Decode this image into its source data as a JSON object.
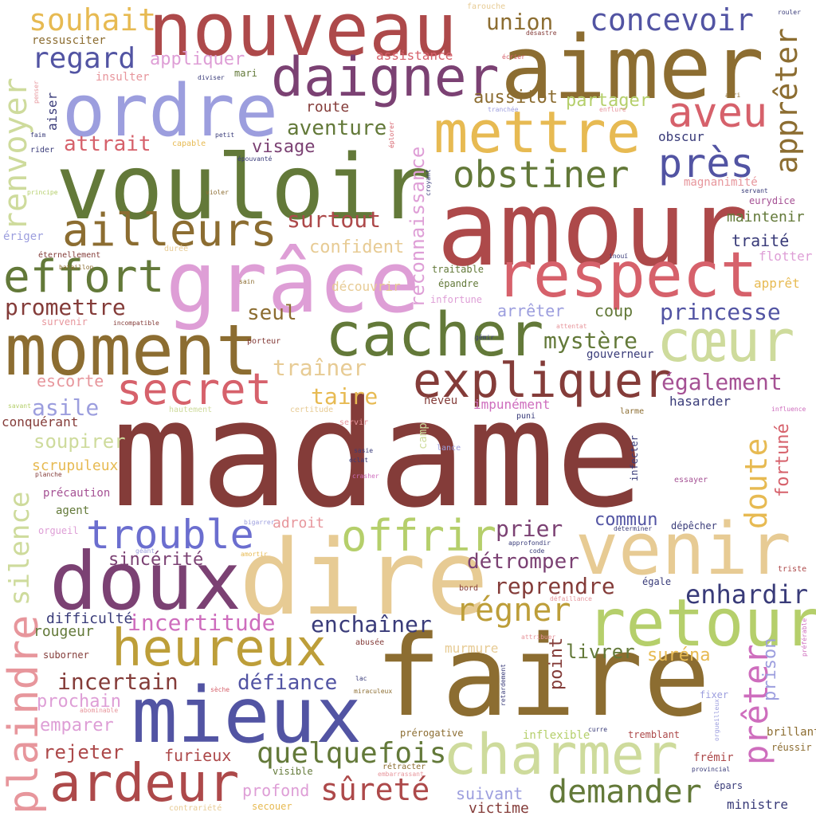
{
  "colors": {
    "maroon": "#843c39",
    "red": "#ad494a",
    "rose": "#d6616b",
    "pink": "#e7969c",
    "olive": "#637939",
    "lime": "#b5cf6b",
    "sage": "#cedb9c",
    "khaki": "#8c6d31",
    "gold": "#bd9e39",
    "mustard": "#e7ba52",
    "sand": "#e7cb94",
    "navy": "#393b79",
    "blue": "#5254a3",
    "periwinkle": "#6b6ecf",
    "lavender": "#9c9ede",
    "plum": "#7b4173",
    "orchid": "#a55194",
    "magenta": "#ce6dbd",
    "lilac": "#de9ed6"
  },
  "words": [
    {
      "text": "madame",
      "c": "maroon"
    },
    {
      "text": "amour",
      "c": "red"
    },
    {
      "text": "vouloir",
      "c": "olive"
    },
    {
      "text": "faire",
      "c": "khaki"
    },
    {
      "text": "dire",
      "c": "sand"
    },
    {
      "text": "aimer",
      "c": "khaki"
    },
    {
      "text": "nouveau",
      "c": "red"
    },
    {
      "text": "grâce",
      "c": "lilac"
    },
    {
      "text": "ordre",
      "c": "lavender"
    },
    {
      "text": "moment",
      "c": "khaki"
    },
    {
      "text": "venir",
      "c": "sand"
    },
    {
      "text": "doux",
      "c": "plum"
    },
    {
      "text": "mieux",
      "c": "blue"
    },
    {
      "text": "respect",
      "c": "rose"
    },
    {
      "text": "retour",
      "c": "lime"
    },
    {
      "text": "cœur",
      "c": "sage"
    },
    {
      "text": "cacher",
      "c": "olive"
    },
    {
      "text": "charmer",
      "c": "sage"
    },
    {
      "text": "mettre",
      "c": "mustard"
    },
    {
      "text": "daigner",
      "c": "plum"
    },
    {
      "text": "heureux",
      "c": "gold"
    },
    {
      "text": "ardeur",
      "c": "red"
    },
    {
      "text": "expliquer",
      "c": "maroon"
    },
    {
      "text": "effort",
      "c": "olive"
    },
    {
      "text": "ailleurs",
      "c": "khaki"
    },
    {
      "text": "secret",
      "c": "rose"
    },
    {
      "text": "offrir",
      "c": "lime"
    },
    {
      "text": "trouble",
      "c": "periwinkle"
    },
    {
      "text": "aveu",
      "c": "rose"
    },
    {
      "text": "obstiner",
      "c": "olive"
    },
    {
      "text": "près",
      "c": "blue"
    },
    {
      "text": "plaindre",
      "c": "pink"
    },
    {
      "text": "renvoyer",
      "c": "sage"
    },
    {
      "text": "apprêter",
      "c": "khaki"
    },
    {
      "text": "prêter",
      "c": "magenta"
    },
    {
      "text": "demander",
      "c": "olive"
    },
    {
      "text": "souhait",
      "c": "mustard"
    },
    {
      "text": "concevoir",
      "c": "blue"
    },
    {
      "text": "régner",
      "c": "gold"
    },
    {
      "text": "quelquefois",
      "c": "olive"
    },
    {
      "text": "sûreté",
      "c": "red"
    },
    {
      "text": "doute",
      "c": "mustard"
    },
    {
      "text": "incertitude",
      "c": "magenta"
    },
    {
      "text": "silence",
      "c": "sage"
    },
    {
      "text": "regard",
      "c": "blue"
    },
    {
      "text": "promettre",
      "c": "maroon"
    },
    {
      "text": "enhardir",
      "c": "navy"
    },
    {
      "text": "incertain",
      "c": "maroon"
    },
    {
      "text": "enchaîner",
      "c": "navy"
    },
    {
      "text": "également",
      "c": "orchid"
    },
    {
      "text": "mystère",
      "c": "olive"
    },
    {
      "text": "princesse",
      "c": "blue"
    },
    {
      "text": "reprendre",
      "c": "maroon"
    },
    {
      "text": "reconnaissance",
      "c": "lilac"
    },
    {
      "text": "défiance",
      "c": "blue"
    },
    {
      "text": "attrait",
      "c": "rose"
    },
    {
      "text": "surtout",
      "c": "red"
    },
    {
      "text": "aventure",
      "c": "olive"
    },
    {
      "text": "traîner",
      "c": "sand"
    },
    {
      "text": "taire",
      "c": "mustard"
    },
    {
      "text": "détromper",
      "c": "plum"
    },
    {
      "text": "prier",
      "c": "plum"
    },
    {
      "text": "asile",
      "c": "lavender"
    },
    {
      "text": "seul",
      "c": "khaki"
    },
    {
      "text": "rejeter",
      "c": "red"
    },
    {
      "text": "union",
      "c": "khaki"
    },
    {
      "text": "partager",
      "c": "lime"
    },
    {
      "text": "aussitôt",
      "c": "khaki"
    },
    {
      "text": "visage",
      "c": "plum"
    },
    {
      "text": "confident",
      "c": "sand"
    },
    {
      "text": "appliquer",
      "c": "lilac"
    },
    {
      "text": "sincérité",
      "c": "plum"
    },
    {
      "text": "prochain",
      "c": "lilac"
    },
    {
      "text": "emparer",
      "c": "lilac"
    },
    {
      "text": "soupirer",
      "c": "sage"
    },
    {
      "text": "fortuné",
      "c": "rose"
    },
    {
      "text": "prison",
      "c": "lavender"
    },
    {
      "text": "livrer",
      "c": "olive"
    },
    {
      "text": "point",
      "c": "maroon"
    },
    {
      "text": "suréna",
      "c": "mustard"
    },
    {
      "text": "commun",
      "c": "blue"
    },
    {
      "text": "furieux",
      "c": "red"
    },
    {
      "text": "profond",
      "c": "lilac"
    },
    {
      "text": "suivant",
      "c": "lavender"
    },
    {
      "text": "victime",
      "c": "maroon"
    },
    {
      "text": "difficulté",
      "c": "navy"
    },
    {
      "text": "rougeur",
      "c": "olive"
    },
    {
      "text": "escorte",
      "c": "pink"
    },
    {
      "text": "scrupuleux",
      "c": "mustard"
    },
    {
      "text": "coup",
      "c": "olive"
    },
    {
      "text": "arrêter",
      "c": "lavender"
    },
    {
      "text": "maintenir",
      "c": "olive"
    },
    {
      "text": "traité",
      "c": "navy"
    },
    {
      "text": "flotter",
      "c": "lilac"
    },
    {
      "text": "route",
      "c": "maroon"
    },
    {
      "text": "ressusciter",
      "c": "khaki"
    },
    {
      "text": "assistance",
      "c": "rose"
    },
    {
      "text": "aiser",
      "c": "navy"
    },
    {
      "text": "obscur",
      "c": "navy"
    },
    {
      "text": "découvrir",
      "c": "sand"
    },
    {
      "text": "murmure",
      "c": "sand"
    },
    {
      "text": "adroit",
      "c": "pink"
    },
    {
      "text": "hasarder",
      "c": "navy"
    },
    {
      "text": "impunément",
      "c": "magenta"
    },
    {
      "text": "conquérant",
      "c": "maroon"
    },
    {
      "text": "précaution",
      "c": "orchid"
    },
    {
      "text": "ministre",
      "c": "navy"
    },
    {
      "text": "gouverneur",
      "c": "navy"
    },
    {
      "text": "insulter",
      "c": "pink"
    },
    {
      "text": "magnanimité",
      "c": "pink"
    },
    {
      "text": "prérogative",
      "c": "khaki"
    },
    {
      "text": "apprêt",
      "c": "mustard"
    },
    {
      "text": "neveu",
      "c": "maroon"
    },
    {
      "text": "infecter",
      "c": "navy"
    },
    {
      "text": "camp",
      "c": "sage"
    },
    {
      "text": "brillant",
      "c": "khaki"
    },
    {
      "text": "frémir",
      "c": "red"
    },
    {
      "text": "tremblant",
      "c": "red"
    },
    {
      "text": "inflexible",
      "c": "lime"
    },
    {
      "text": "servir",
      "c": "pink"
    },
    {
      "text": "infortune",
      "c": "lilac"
    },
    {
      "text": "agent",
      "c": "olive"
    },
    {
      "text": "mari",
      "c": "olive"
    },
    {
      "text": "fixer",
      "c": "lavender"
    },
    {
      "text": "orgueil",
      "c": "lilac"
    },
    {
      "text": "visible",
      "c": "olive"
    },
    {
      "text": "épars",
      "c": "navy"
    },
    {
      "text": "réussir",
      "c": "khaki"
    },
    {
      "text": "dépêcher",
      "c": "navy"
    },
    {
      "text": "capable",
      "c": "mustard"
    },
    {
      "text": "traitable",
      "c": "olive"
    },
    {
      "text": "épandre",
      "c": "olive"
    },
    {
      "text": "certitude",
      "c": "sand"
    },
    {
      "text": "porteur",
      "c": "maroon"
    },
    {
      "text": "lance",
      "c": "lavender"
    },
    {
      "text": "essayer",
      "c": "orchid"
    },
    {
      "text": "durée",
      "c": "sand"
    },
    {
      "text": "hautement",
      "c": "sage"
    },
    {
      "text": "éternellement",
      "c": "maroon"
    },
    {
      "text": "ériger",
      "c": "lavender"
    },
    {
      "text": "survenir",
      "c": "pink"
    },
    {
      "text": "eurydice",
      "c": "orchid"
    },
    {
      "text": "triste",
      "c": "red"
    },
    {
      "text": "égale",
      "c": "navy"
    },
    {
      "text": "bord",
      "c": "maroon"
    },
    {
      "text": "larme",
      "c": "khaki"
    },
    {
      "text": "abusée",
      "c": "maroon"
    },
    {
      "text": "suborner",
      "c": "maroon"
    },
    {
      "text": "farouche",
      "c": "sand"
    },
    {
      "text": "rouler",
      "c": "navy"
    },
    {
      "text": "désastre",
      "c": "maroon"
    },
    {
      "text": "écrier",
      "c": "rose"
    },
    {
      "text": "abri",
      "c": "khaki"
    },
    {
      "text": "enflure",
      "c": "pink"
    },
    {
      "text": "tranchée",
      "c": "lavender"
    },
    {
      "text": "faim",
      "c": "navy"
    },
    {
      "text": "rider",
      "c": "navy"
    },
    {
      "text": "petit",
      "c": "navy"
    },
    {
      "text": "épouvanté",
      "c": "navy"
    },
    {
      "text": "diviser",
      "c": "navy"
    },
    {
      "text": "penser",
      "c": "pink"
    },
    {
      "text": "éplorer",
      "c": "rose"
    },
    {
      "text": "croyant",
      "c": "navy"
    },
    {
      "text": "principe",
      "c": "lime"
    },
    {
      "text": "violer",
      "c": "khaki"
    },
    {
      "text": "servant",
      "c": "navy"
    },
    {
      "text": "bataillon",
      "c": "khaki"
    },
    {
      "text": "inouï",
      "c": "navy"
    },
    {
      "text": "sain",
      "c": "khaki"
    },
    {
      "text": "incompatible",
      "c": "maroon"
    },
    {
      "text": "attentat",
      "c": "pink"
    },
    {
      "text": "gémir",
      "c": "navy"
    },
    {
      "text": "savant",
      "c": "lime"
    },
    {
      "text": "influence",
      "c": "magenta"
    },
    {
      "text": "puni",
      "c": "navy"
    },
    {
      "text": "sasie",
      "c": "navy"
    },
    {
      "text": "éclat",
      "c": "navy"
    },
    {
      "text": "crasher",
      "c": "magenta"
    },
    {
      "text": "planche",
      "c": "maroon"
    },
    {
      "text": "bigarrer",
      "c": "lavender"
    },
    {
      "text": "amortir",
      "c": "mustard"
    },
    {
      "text": "géant",
      "c": "lavender"
    },
    {
      "text": "approfondir",
      "c": "navy"
    },
    {
      "text": "code",
      "c": "navy"
    },
    {
      "text": "déterminer",
      "c": "navy"
    },
    {
      "text": "défaillance",
      "c": "pink"
    },
    {
      "text": "préférable",
      "c": "magenta"
    },
    {
      "text": "attribuer",
      "c": "pink"
    },
    {
      "text": "retardement",
      "c": "navy"
    },
    {
      "text": "lac",
      "c": "navy"
    },
    {
      "text": "miraculeux",
      "c": "khaki"
    },
    {
      "text": "sèche",
      "c": "rose"
    },
    {
      "text": "abominable",
      "c": "pink"
    },
    {
      "text": "orgueilleux",
      "c": "lavender"
    },
    {
      "text": "curre",
      "c": "navy"
    },
    {
      "text": "provincial",
      "c": "navy"
    },
    {
      "text": "rétracter",
      "c": "khaki"
    },
    {
      "text": "embarrassant",
      "c": "pink"
    },
    {
      "text": "contrariété",
      "c": "sand"
    },
    {
      "text": "secouer",
      "c": "mustard"
    }
  ]
}
